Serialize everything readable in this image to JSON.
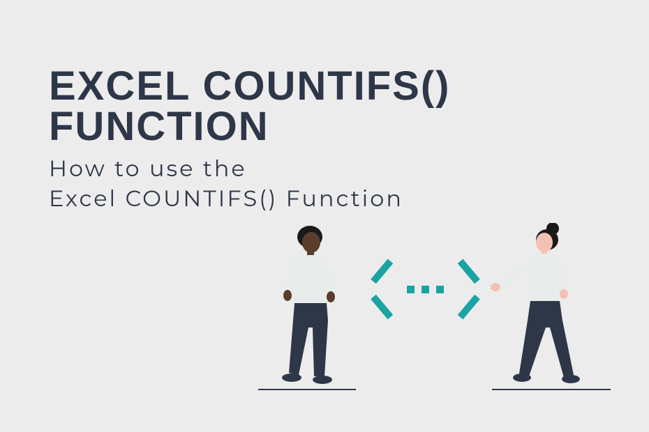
{
  "title": "EXCEL COUNTIFS() FUNCTION",
  "subtitle_line1": "How to use the",
  "subtitle_line2": "Excel COUNTIFS() Function",
  "colors": {
    "background": "#edecec",
    "text": "#2d3748",
    "accent": "#1aa3a3",
    "skin_left": "#5a3d2b",
    "skin_right": "#f4c2b4",
    "shirt": "#e8ecea",
    "pants": "#2d3748"
  }
}
